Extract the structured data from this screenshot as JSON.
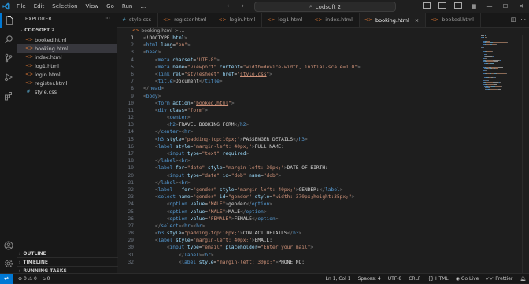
{
  "app": {
    "menu": [
      "File",
      "Edit",
      "Selection",
      "View",
      "Go",
      "Run",
      "…"
    ],
    "search": "codsoft 2"
  },
  "sidebar": {
    "title": "EXPLORER",
    "folder": "CODSOFT 2",
    "files": [
      {
        "name": "booked.html",
        "type": "html",
        "selected": false
      },
      {
        "name": "booking.html",
        "type": "html",
        "selected": true
      },
      {
        "name": "index.html",
        "type": "html",
        "selected": false
      },
      {
        "name": "log1.html",
        "type": "html",
        "selected": false
      },
      {
        "name": "login.html",
        "type": "html",
        "selected": false
      },
      {
        "name": "register.html",
        "type": "html",
        "selected": false
      },
      {
        "name": "style.css",
        "type": "css",
        "selected": false
      }
    ],
    "sections": [
      "OUTLINE",
      "TIMELINE",
      "RUNNING TASKS"
    ]
  },
  "tabs": [
    {
      "label": "style.css",
      "type": "css",
      "active": false
    },
    {
      "label": "register.html",
      "type": "html",
      "active": false
    },
    {
      "label": "login.html",
      "type": "html",
      "active": false
    },
    {
      "label": "log1.html",
      "type": "html",
      "active": false
    },
    {
      "label": "index.html",
      "type": "html",
      "active": false
    },
    {
      "label": "booking.html",
      "type": "html",
      "active": true
    },
    {
      "label": "booked.html",
      "type": "html",
      "active": false
    }
  ],
  "breadcrumb": {
    "file": "booking.html",
    "rest": "> ..."
  },
  "code": [
    [
      [
        "pu",
        "<"
      ],
      [
        "tx",
        "!DOCTYPE "
      ],
      [
        "at",
        "html"
      ],
      [
        "pu",
        ">"
      ]
    ],
    [
      [
        "pu",
        "<"
      ],
      [
        "tg",
        "html "
      ],
      [
        "at",
        "lang"
      ],
      [
        "tx",
        "="
      ],
      [
        "st",
        "\"en\""
      ],
      [
        "pu",
        ">"
      ]
    ],
    [
      [
        "pu",
        "<"
      ],
      [
        "tg",
        "head"
      ],
      [
        "pu",
        ">"
      ]
    ],
    [
      [
        "tx",
        "    "
      ],
      [
        "pu",
        "<"
      ],
      [
        "tg",
        "meta "
      ],
      [
        "at",
        "charset"
      ],
      [
        "tx",
        "="
      ],
      [
        "st",
        "\"UTF-8\""
      ],
      [
        "pu",
        ">"
      ]
    ],
    [
      [
        "tx",
        "    "
      ],
      [
        "pu",
        "<"
      ],
      [
        "tg",
        "meta "
      ],
      [
        "at",
        "name"
      ],
      [
        "tx",
        "="
      ],
      [
        "st",
        "\"viewport\" "
      ],
      [
        "at",
        "content"
      ],
      [
        "tx",
        "="
      ],
      [
        "st",
        "\"width=device-width, initial-scale=1.0\""
      ],
      [
        "pu",
        ">"
      ]
    ],
    [
      [
        "tx",
        "    "
      ],
      [
        "pu",
        "<"
      ],
      [
        "tg",
        "link "
      ],
      [
        "at",
        "rel"
      ],
      [
        "tx",
        "="
      ],
      [
        "st",
        "\"stylesheet\" "
      ],
      [
        "at",
        "href"
      ],
      [
        "tx",
        "="
      ],
      [
        "st",
        "\""
      ],
      [
        "stu",
        "style.css"
      ],
      [
        "st",
        "\""
      ],
      [
        "pu",
        ">"
      ]
    ],
    [
      [
        "tx",
        "    "
      ],
      [
        "pu",
        "<"
      ],
      [
        "tg",
        "title"
      ],
      [
        "pu",
        ">"
      ],
      [
        "tx",
        "Document"
      ],
      [
        "pu",
        "</"
      ],
      [
        "tg",
        "title"
      ],
      [
        "pu",
        ">"
      ]
    ],
    [
      [
        "pu",
        "</"
      ],
      [
        "tg",
        "head"
      ],
      [
        "pu",
        ">"
      ]
    ],
    [
      [
        "pu",
        "<"
      ],
      [
        "tg",
        "body"
      ],
      [
        "pu",
        ">"
      ]
    ],
    [
      [
        "tx",
        "    "
      ],
      [
        "pu",
        "<"
      ],
      [
        "tg",
        "form "
      ],
      [
        "at",
        "action"
      ],
      [
        "tx",
        "="
      ],
      [
        "st",
        "\""
      ],
      [
        "stu",
        "booked.html"
      ],
      [
        "st",
        "\""
      ],
      [
        "pu",
        ">"
      ]
    ],
    [
      [
        "tx",
        "    "
      ],
      [
        "pu",
        "<"
      ],
      [
        "tg",
        "div "
      ],
      [
        "at",
        "class"
      ],
      [
        "tx",
        "="
      ],
      [
        "st",
        "\"form\""
      ],
      [
        "pu",
        ">"
      ]
    ],
    [
      [
        "tx",
        "        "
      ],
      [
        "pu",
        "<"
      ],
      [
        "tg",
        "center"
      ],
      [
        "pu",
        ">"
      ]
    ],
    [
      [
        "tx",
        "        "
      ],
      [
        "pu",
        "<"
      ],
      [
        "tg",
        "h2"
      ],
      [
        "pu",
        ">"
      ],
      [
        "tx",
        "TRAVEL BOOKING FORM"
      ],
      [
        "pu",
        "</"
      ],
      [
        "tg",
        "h2"
      ],
      [
        "pu",
        ">"
      ]
    ],
    [
      [
        "tx",
        "    "
      ],
      [
        "pu",
        "</"
      ],
      [
        "tg",
        "center"
      ],
      [
        "pu",
        "><"
      ],
      [
        "tg",
        "hr"
      ],
      [
        "pu",
        ">"
      ]
    ],
    [
      [
        "tx",
        "    "
      ],
      [
        "pu",
        "<"
      ],
      [
        "tg",
        "h3 "
      ],
      [
        "at",
        "style"
      ],
      [
        "tx",
        "="
      ],
      [
        "st",
        "\"padding-top:10px;\""
      ],
      [
        "pu",
        ">"
      ],
      [
        "tx",
        "PASSENGER DETAILS"
      ],
      [
        "pu",
        "</"
      ],
      [
        "tg",
        "h3"
      ],
      [
        "pu",
        ">"
      ]
    ],
    [
      [
        "tx",
        "    "
      ],
      [
        "pu",
        "<"
      ],
      [
        "tg",
        "label "
      ],
      [
        "at",
        "style"
      ],
      [
        "tx",
        "="
      ],
      [
        "st",
        "\"margin-left: 40px;\""
      ],
      [
        "pu",
        ">"
      ],
      [
        "tx",
        "FULL NAME:"
      ]
    ],
    [
      [
        "tx",
        "        "
      ],
      [
        "pu",
        "<"
      ],
      [
        "tg",
        "input "
      ],
      [
        "at",
        "type"
      ],
      [
        "tx",
        "="
      ],
      [
        "st",
        "\"text\" "
      ],
      [
        "at",
        "required"
      ],
      [
        "pu",
        ">"
      ]
    ],
    [
      [
        "tx",
        "    "
      ],
      [
        "pu",
        "</"
      ],
      [
        "tg",
        "label"
      ],
      [
        "pu",
        "><"
      ],
      [
        "tg",
        "br"
      ],
      [
        "pu",
        ">"
      ]
    ],
    [
      [
        "tx",
        "    "
      ],
      [
        "pu",
        "<"
      ],
      [
        "tg",
        "label "
      ],
      [
        "at",
        "for"
      ],
      [
        "tx",
        "="
      ],
      [
        "st",
        "\"date\" "
      ],
      [
        "at",
        "style"
      ],
      [
        "tx",
        "="
      ],
      [
        "st",
        "\"margin-left: 30px;\""
      ],
      [
        "pu",
        ">"
      ],
      [
        "tx",
        "DATE OF BIRTH:"
      ]
    ],
    [
      [
        "tx",
        "        "
      ],
      [
        "pu",
        "<"
      ],
      [
        "tg",
        "input "
      ],
      [
        "at",
        "type"
      ],
      [
        "tx",
        "="
      ],
      [
        "st",
        "\"date\" "
      ],
      [
        "at",
        "id"
      ],
      [
        "tx",
        "="
      ],
      [
        "st",
        "\"dob\" "
      ],
      [
        "at",
        "name"
      ],
      [
        "tx",
        "="
      ],
      [
        "st",
        "\"dob\""
      ],
      [
        "pu",
        ">"
      ]
    ],
    [
      [
        "tx",
        "    "
      ],
      [
        "pu",
        "</"
      ],
      [
        "tg",
        "label"
      ],
      [
        "pu",
        "><"
      ],
      [
        "tg",
        "br"
      ],
      [
        "pu",
        ">"
      ]
    ],
    [
      [
        "tx",
        "    "
      ],
      [
        "pu",
        "<"
      ],
      [
        "tg",
        "label   "
      ],
      [
        "at",
        "for"
      ],
      [
        "tx",
        "="
      ],
      [
        "st",
        "\"gender\" "
      ],
      [
        "at",
        "style"
      ],
      [
        "tx",
        "="
      ],
      [
        "st",
        "\"margin-left: 40px;\""
      ],
      [
        "pu",
        ">"
      ],
      [
        "tx",
        "GENDER:"
      ],
      [
        "pu",
        "</"
      ],
      [
        "tg",
        "label"
      ],
      [
        "pu",
        ">"
      ]
    ],
    [
      [
        "tx",
        "    "
      ],
      [
        "pu",
        "<"
      ],
      [
        "tg",
        "select "
      ],
      [
        "at",
        "name"
      ],
      [
        "tx",
        "="
      ],
      [
        "st",
        "\"gender\" "
      ],
      [
        "at",
        "id"
      ],
      [
        "tx",
        "="
      ],
      [
        "st",
        "\"gender\" "
      ],
      [
        "at",
        "style"
      ],
      [
        "tx",
        "="
      ],
      [
        "st",
        "\"width: 370px;height:35px;\""
      ],
      [
        "pu",
        ">"
      ]
    ],
    [
      [
        "tx",
        "        "
      ],
      [
        "pu",
        "<"
      ],
      [
        "tg",
        "option "
      ],
      [
        "at",
        "value"
      ],
      [
        "tx",
        "="
      ],
      [
        "st",
        "\"MALE\""
      ],
      [
        "pu",
        ">"
      ],
      [
        "tx",
        "gender"
      ],
      [
        "pu",
        "</"
      ],
      [
        "tg",
        "option"
      ],
      [
        "pu",
        ">"
      ]
    ],
    [
      [
        "tx",
        "        "
      ],
      [
        "pu",
        "<"
      ],
      [
        "tg",
        "option "
      ],
      [
        "at",
        "value"
      ],
      [
        "tx",
        "="
      ],
      [
        "st",
        "\"MALE\""
      ],
      [
        "pu",
        ">"
      ],
      [
        "tx",
        "MALE"
      ],
      [
        "pu",
        "</"
      ],
      [
        "tg",
        "option"
      ],
      [
        "pu",
        ">"
      ]
    ],
    [
      [
        "tx",
        "        "
      ],
      [
        "pu",
        "<"
      ],
      [
        "tg",
        "option "
      ],
      [
        "at",
        "value"
      ],
      [
        "tx",
        "="
      ],
      [
        "st",
        "\"FEMALE\""
      ],
      [
        "pu",
        ">"
      ],
      [
        "tx",
        "FEMALE"
      ],
      [
        "pu",
        "</"
      ],
      [
        "tg",
        "option"
      ],
      [
        "pu",
        ">"
      ]
    ],
    [
      [
        "tx",
        "    "
      ],
      [
        "pu",
        "</"
      ],
      [
        "tg",
        "select"
      ],
      [
        "pu",
        "><"
      ],
      [
        "tg",
        "br"
      ],
      [
        "pu",
        "><"
      ],
      [
        "tg",
        "br"
      ],
      [
        "pu",
        ">"
      ]
    ],
    [
      [
        "tx",
        "    "
      ],
      [
        "pu",
        "<"
      ],
      [
        "tg",
        "h3 "
      ],
      [
        "at",
        "style"
      ],
      [
        "tx",
        "="
      ],
      [
        "st",
        "\"padding-top:10px;\""
      ],
      [
        "pu",
        ">"
      ],
      [
        "tx",
        "CONTACT DETAILS"
      ],
      [
        "pu",
        "</"
      ],
      [
        "tg",
        "h3"
      ],
      [
        "pu",
        ">"
      ]
    ],
    [
      [
        "tx",
        "    "
      ],
      [
        "pu",
        "<"
      ],
      [
        "tg",
        "label "
      ],
      [
        "at",
        "style"
      ],
      [
        "tx",
        "="
      ],
      [
        "st",
        "\"margin-left: 40px;\""
      ],
      [
        "pu",
        ">"
      ],
      [
        "tx",
        "EMAIL:"
      ]
    ],
    [
      [
        "tx",
        "        "
      ],
      [
        "pu",
        "<"
      ],
      [
        "tg",
        "input "
      ],
      [
        "at",
        "type"
      ],
      [
        "tx",
        "="
      ],
      [
        "st",
        "\"email\" "
      ],
      [
        "at",
        "placeholder"
      ],
      [
        "tx",
        "="
      ],
      [
        "st",
        "\"Enter your mail\""
      ],
      [
        "pu",
        ">"
      ]
    ],
    [
      [
        "tx",
        "            "
      ],
      [
        "pu",
        "</"
      ],
      [
        "tg",
        "label"
      ],
      [
        "pu",
        "><"
      ],
      [
        "tg",
        "br"
      ],
      [
        "pu",
        ">"
      ]
    ],
    [
      [
        "tx",
        "            "
      ],
      [
        "pu",
        "<"
      ],
      [
        "tg",
        "label "
      ],
      [
        "at",
        "style"
      ],
      [
        "tx",
        "="
      ],
      [
        "st",
        "\"margin-left: 30px;\""
      ],
      [
        "pu",
        ">"
      ],
      [
        "tx",
        "PHONE NO:"
      ]
    ]
  ],
  "status": {
    "errors": "0",
    "warnings": "0",
    "ports": "0",
    "position": "Ln 1, Col 1",
    "spaces": "Spaces: 4",
    "encoding": "UTF-8",
    "eol": "CRLF",
    "language": "HTML",
    "golive": "Go Live",
    "prettier": "Prettier"
  }
}
